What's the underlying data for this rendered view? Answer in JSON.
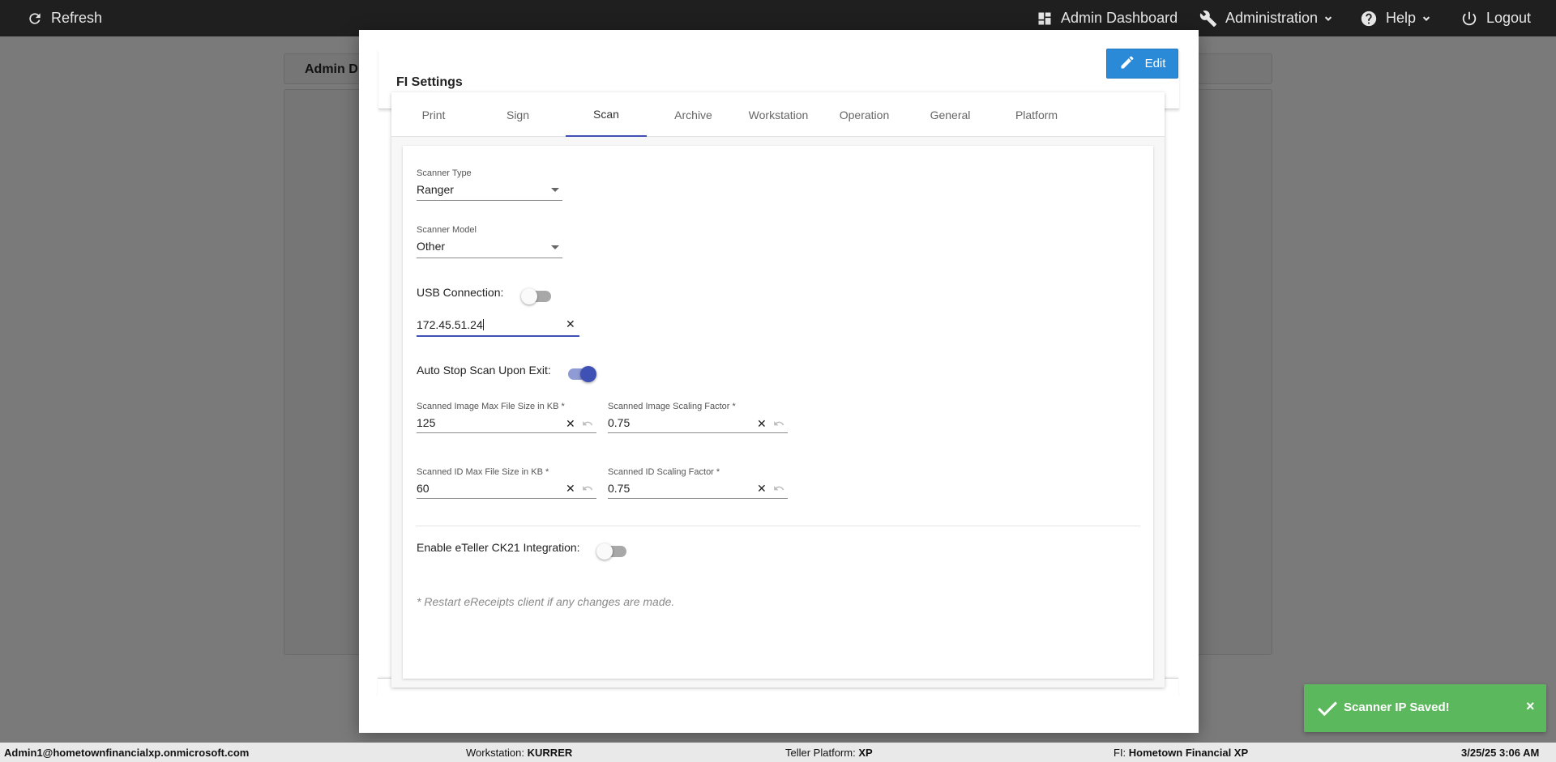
{
  "topbar": {
    "refresh_label": "Refresh",
    "admin_dashboard_label": "Admin Dashboard",
    "administration_label": "Administration",
    "help_label": "Help",
    "logout_label": "Logout"
  },
  "background": {
    "page_title": "Admin D"
  },
  "modal": {
    "title": "FI Settings",
    "edit_label": "Edit",
    "tabs": [
      {
        "label": "Print"
      },
      {
        "label": "Sign"
      },
      {
        "label": "Scan"
      },
      {
        "label": "Archive"
      },
      {
        "label": "Workstation"
      },
      {
        "label": "Operation"
      },
      {
        "label": "General"
      },
      {
        "label": "Platform"
      }
    ],
    "active_tab": "Scan"
  },
  "scan": {
    "scanner_type": {
      "label": "Scanner Type",
      "value": "Ranger"
    },
    "scanner_model": {
      "label": "Scanner Model",
      "value": "Other"
    },
    "usb_connection": {
      "label": "USB Connection:",
      "on": false
    },
    "scanner_ip": {
      "value": "172.45.51.24"
    },
    "auto_stop": {
      "label": "Auto Stop Scan Upon Exit:",
      "on": true
    },
    "image_max_size": {
      "label": "Scanned Image Max File Size in KB *",
      "value": "125"
    },
    "image_scaling": {
      "label": "Scanned Image Scaling Factor *",
      "value": "0.75"
    },
    "id_max_size": {
      "label": "Scanned ID Max File Size in KB *",
      "value": "60"
    },
    "id_scaling": {
      "label": "Scanned ID Scaling Factor *",
      "value": "0.75"
    },
    "ck21": {
      "label": "Enable eTeller CK21 Integration:",
      "on": false
    },
    "restart_note": "* Restart eReceipts client if any changes are made."
  },
  "toast": {
    "message": "Scanner IP Saved!",
    "close": "×"
  },
  "statusbar": {
    "user": "Admin1@hometownfinancialxp.onmicrosoft.com",
    "workstation_label": "Workstation:",
    "workstation_value": "KURRER",
    "platform_label": "Teller Platform:",
    "platform_value": "XP",
    "fi_label": "FI:",
    "fi_value": "Hometown Financial XP",
    "datetime": "3/25/25 3:06 AM"
  },
  "colors": {
    "accent": "#3f51b5",
    "edit_button": "#2b8ad8",
    "toast_success": "#5cb85c",
    "topbar": "#1f1f1f"
  },
  "icons": [
    "refresh-icon",
    "dashboard-icon",
    "wrench-icon",
    "help-icon",
    "power-icon",
    "pencil-icon",
    "check-icon",
    "close-icon",
    "undo-icon",
    "chevron-down-icon"
  ]
}
